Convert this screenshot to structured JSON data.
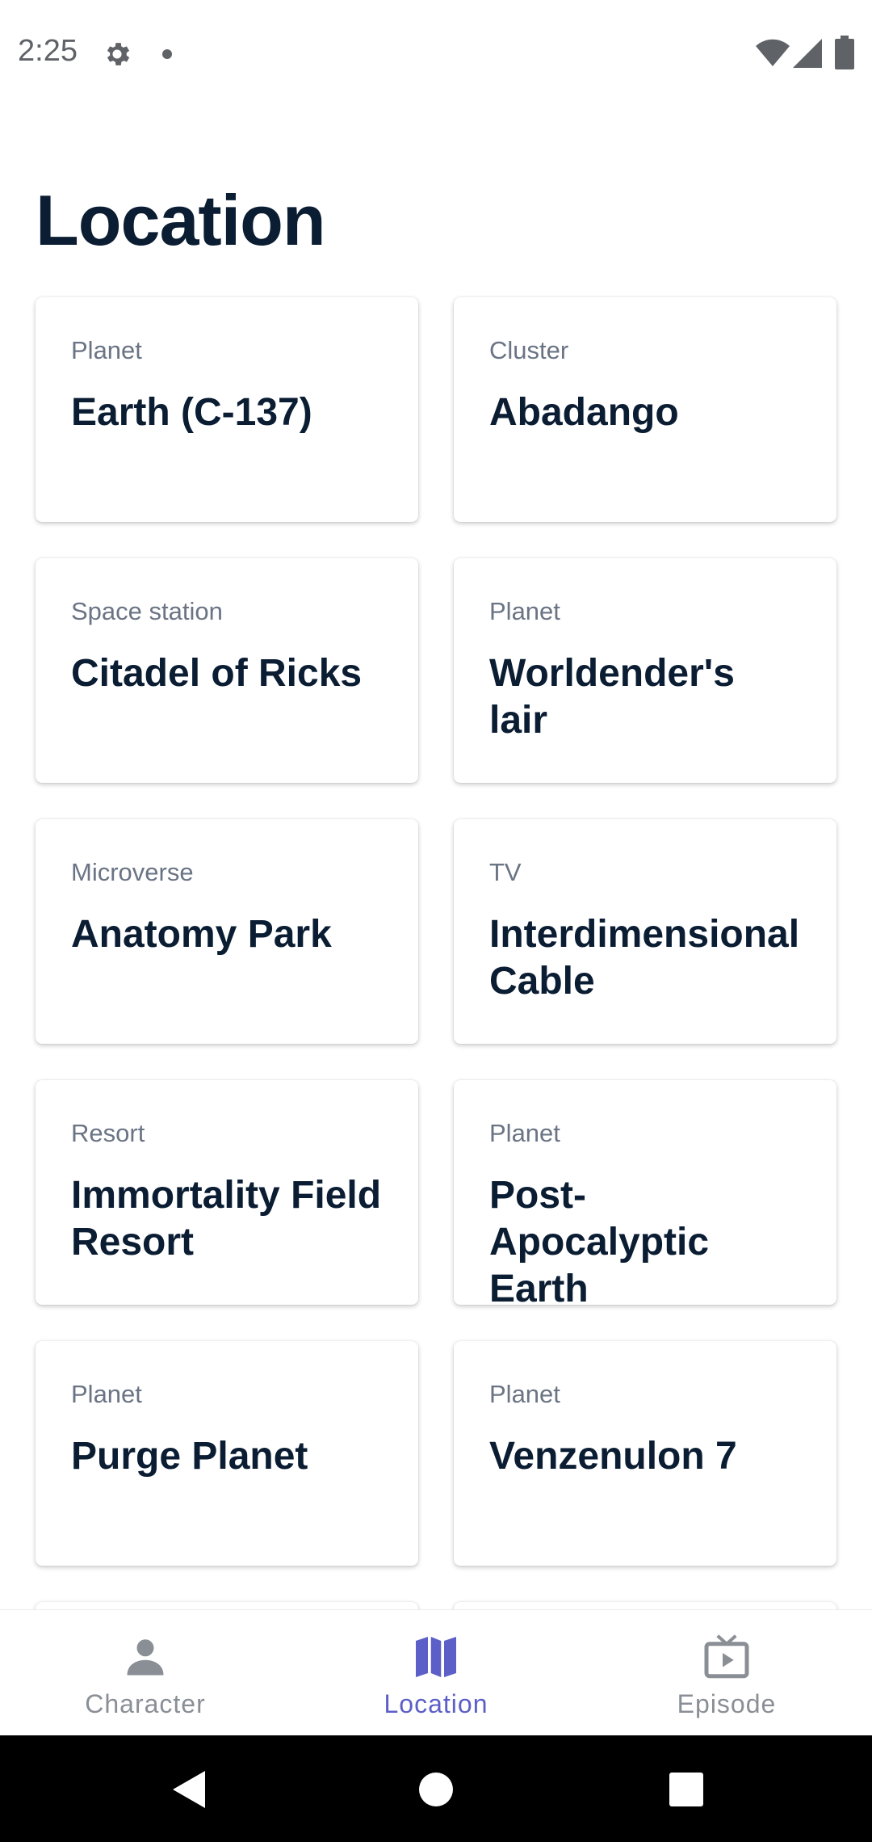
{
  "status_bar": {
    "time": "2:25",
    "icons": [
      "settings-icon",
      "notification-dot-icon",
      "wifi-icon",
      "signal-icon",
      "battery-icon"
    ]
  },
  "page": {
    "title": "Location"
  },
  "locations": [
    {
      "type": "Planet",
      "name": "Earth (C-137)"
    },
    {
      "type": "Cluster",
      "name": "Abadango"
    },
    {
      "type": "Space station",
      "name": "Citadel of Ricks"
    },
    {
      "type": "Planet",
      "name": "Worldender's lair"
    },
    {
      "type": "Microverse",
      "name": "Anatomy Park"
    },
    {
      "type": "TV",
      "name": "Interdimensional Cable"
    },
    {
      "type": "Resort",
      "name": "Immortality Field Resort"
    },
    {
      "type": "Planet",
      "name": "Post-Apocalyptic Earth"
    },
    {
      "type": "Planet",
      "name": "Purge Planet"
    },
    {
      "type": "Planet",
      "name": "Venzenulon 7"
    }
  ],
  "bottom_nav": {
    "items": [
      {
        "label": "Character",
        "icon": "person-icon",
        "active": false
      },
      {
        "label": "Location",
        "icon": "map-icon",
        "active": true
      },
      {
        "label": "Episode",
        "icon": "tv-icon",
        "active": false
      }
    ],
    "active_color": "#5b5fc7",
    "inactive_color": "#8a8f96"
  },
  "system_nav": {
    "buttons": [
      "back-icon",
      "home-icon",
      "recents-icon"
    ]
  },
  "colors": {
    "title": "#0b1d33",
    "card_type": "#6a7484",
    "card_name": "#0b1d33"
  }
}
